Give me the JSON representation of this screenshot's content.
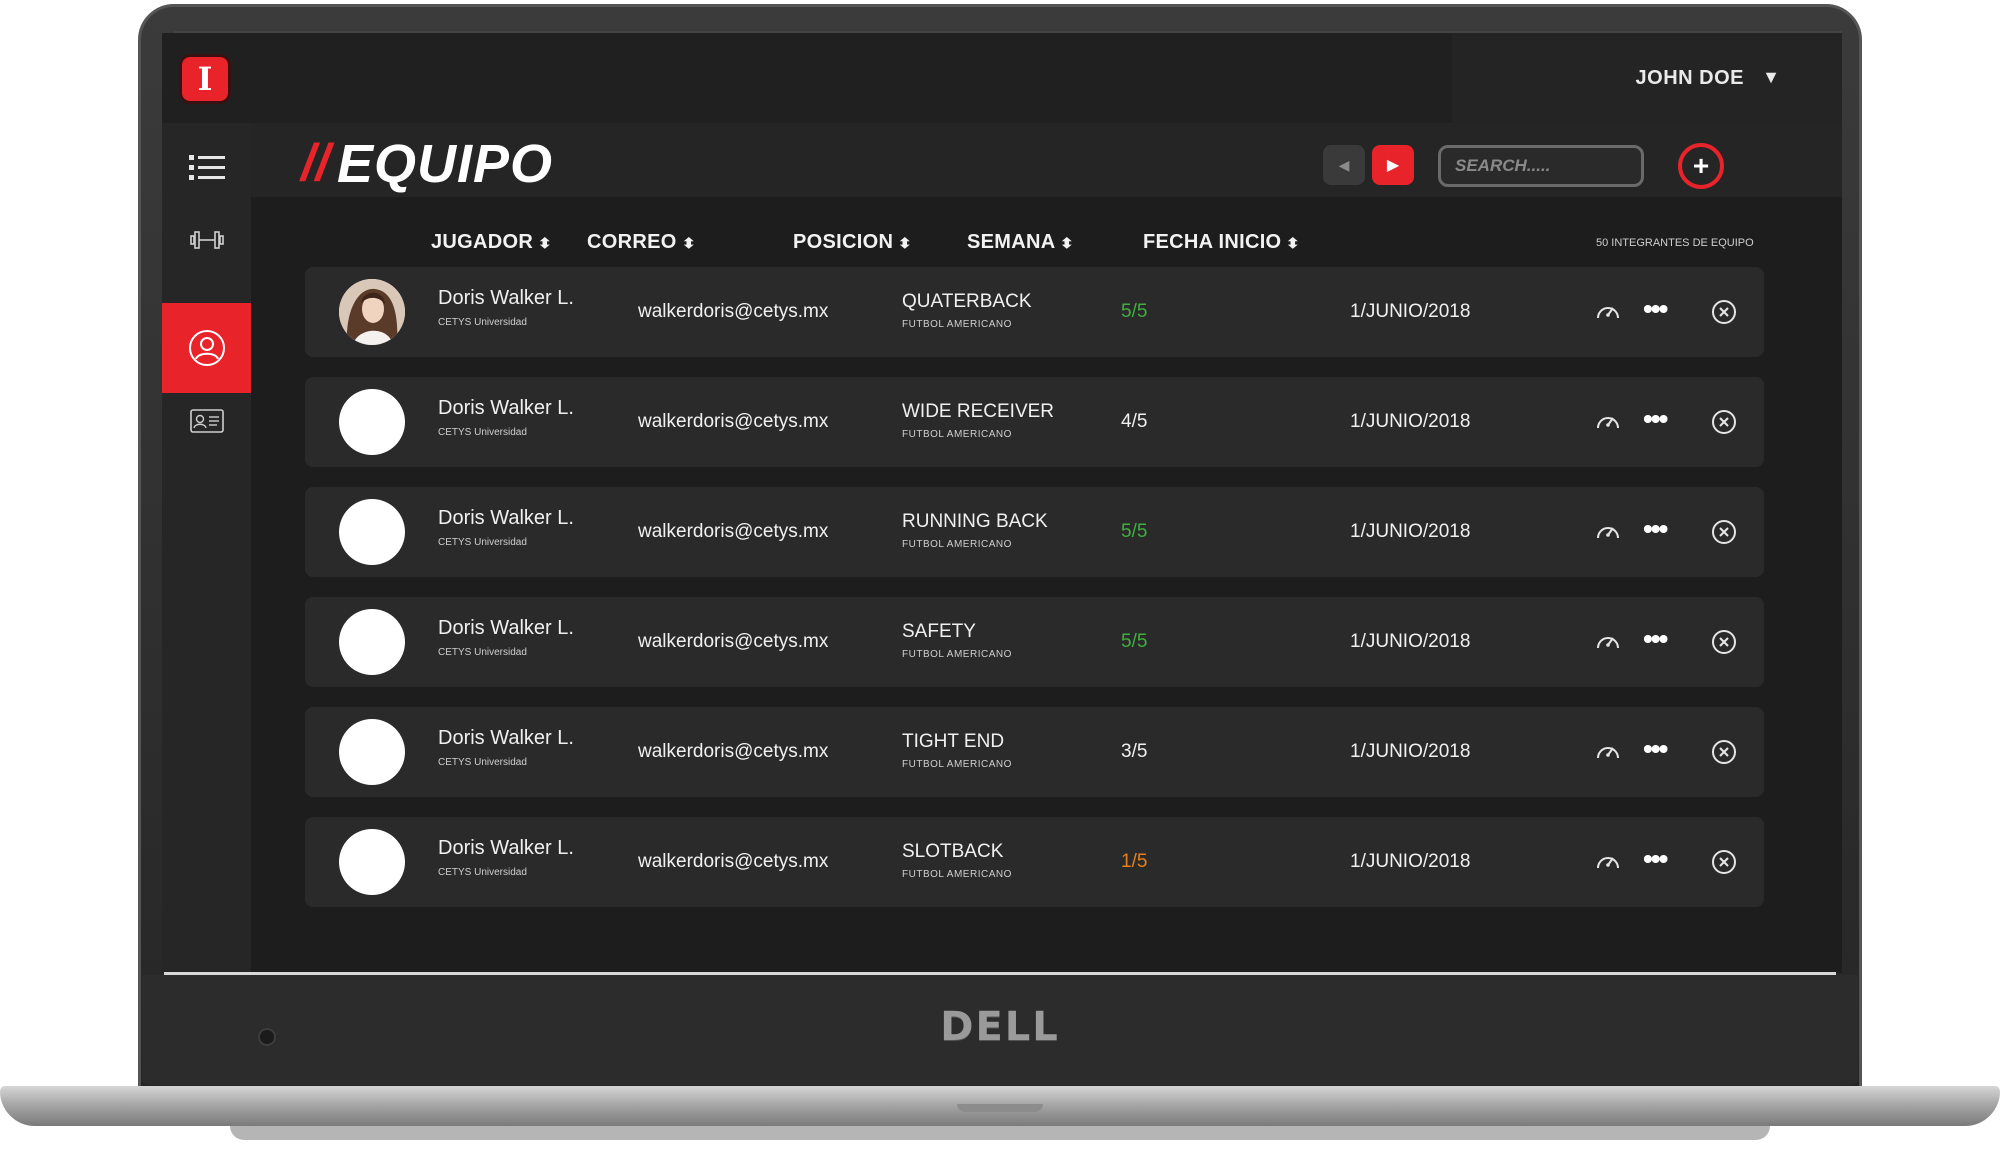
{
  "device": {
    "brand": "DELL"
  },
  "app": {
    "logo_letter": "I",
    "user": {
      "name": "JOHN DOE",
      "caret": "▼"
    },
    "sidebar": {
      "items": [
        {
          "icon": "list-icon",
          "active": false
        },
        {
          "icon": "dumbbell-icon",
          "active": false
        },
        {
          "icon": "user-profile-icon",
          "active": true
        },
        {
          "icon": "id-card-icon",
          "active": false
        }
      ]
    },
    "header": {
      "title_slash": "//",
      "title": "EQUIPO",
      "prev_icon": "◀",
      "next_icon": "▶",
      "search_placeholder": "SEARCH.....",
      "add_icon": "+"
    },
    "table": {
      "columns": [
        "JUGADOR",
        "CORREO",
        "POSICION",
        "SEMANA",
        "FECHA INICIO"
      ],
      "sort_icon": "⬍",
      "count_note": "50 INTEGRANTES DE EQUIPO",
      "week_colors": {
        "complete": "#3fb03f",
        "low": "#e8801a",
        "normal": "#f0f0f0"
      },
      "rows": [
        {
          "name": "Doris Walker L.",
          "org": "CETYS Universidad",
          "email": "walkerdoris@cetys.mx",
          "position": "QUATERBACK",
          "sport": "FUTBOL  AMERICANO",
          "week": "5/5",
          "week_status": "complete",
          "start": "1/JUNIO/2018",
          "has_photo": true
        },
        {
          "name": "Doris Walker L.",
          "org": "CETYS Universidad",
          "email": "walkerdoris@cetys.mx",
          "position": "WIDE RECEIVER",
          "sport": "FUTBOL  AMERICANO",
          "week": "4/5",
          "week_status": "normal",
          "start": "1/JUNIO/2018",
          "has_photo": false
        },
        {
          "name": "Doris Walker L.",
          "org": "CETYS Universidad",
          "email": "walkerdoris@cetys.mx",
          "position": "RUNNING BACK",
          "sport": "FUTBOL  AMERICANO",
          "week": "5/5",
          "week_status": "complete",
          "start": "1/JUNIO/2018",
          "has_photo": false
        },
        {
          "name": "Doris Walker L.",
          "org": "CETYS Universidad",
          "email": "walkerdoris@cetys.mx",
          "position": "SAFETY",
          "sport": "FUTBOL  AMERICANO",
          "week": "5/5",
          "week_status": "complete",
          "start": "1/JUNIO/2018",
          "has_photo": false
        },
        {
          "name": "Doris Walker L.",
          "org": "CETYS Universidad",
          "email": "walkerdoris@cetys.mx",
          "position": "TIGHT END",
          "sport": "FUTBOL  AMERICANO",
          "week": "3/5",
          "week_status": "normal",
          "start": "1/JUNIO/2018",
          "has_photo": false
        },
        {
          "name": "Doris Walker L.",
          "org": "CETYS Universidad",
          "email": "walkerdoris@cetys.mx",
          "position": "SLOTBACK",
          "sport": "FUTBOL  AMERICANO",
          "week": "1/5",
          "week_status": "low",
          "start": "1/JUNIO/2018",
          "has_photo": false
        }
      ],
      "actions": [
        "gauge-icon",
        "more-icon",
        "close-circle-icon"
      ],
      "more_glyph": "•••"
    },
    "colors": {
      "accent": "#e8232a",
      "background": "#1d1d1d",
      "row": "#2a2a2a"
    }
  }
}
